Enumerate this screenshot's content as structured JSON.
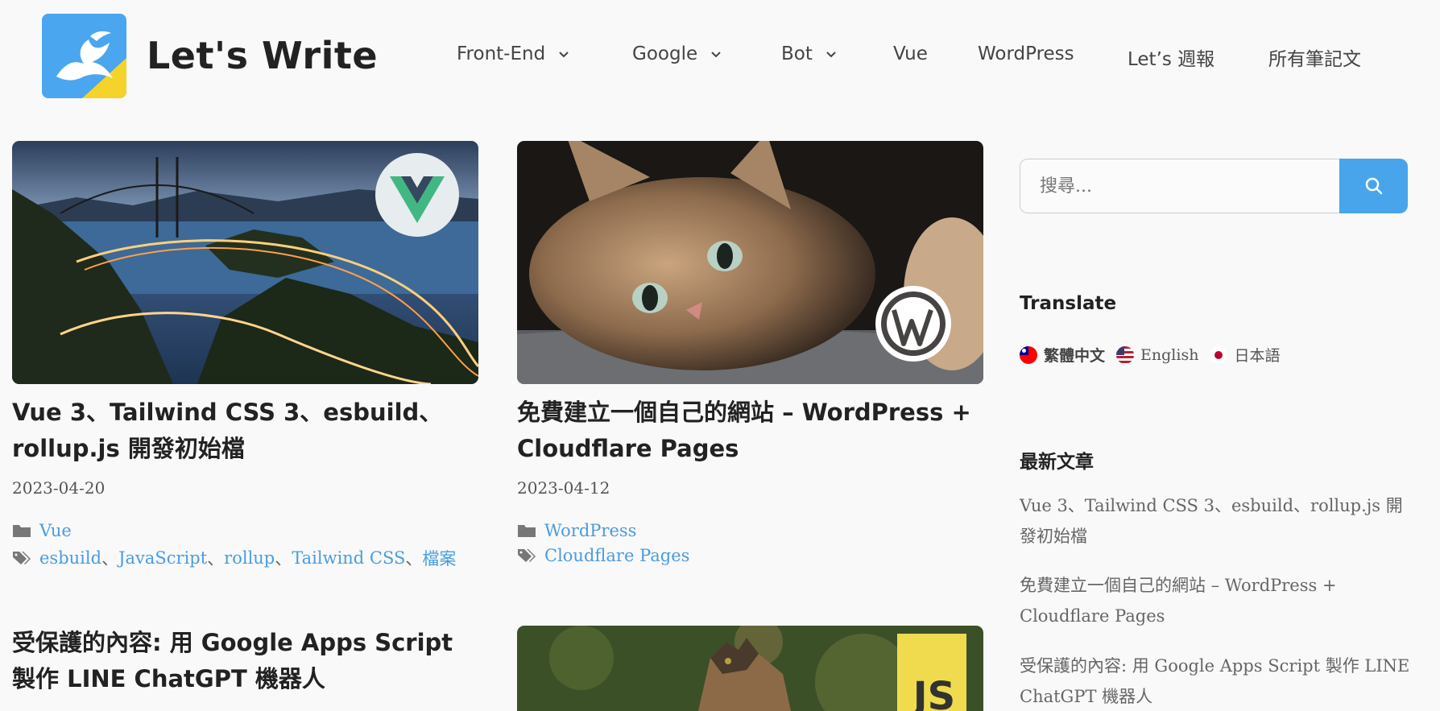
{
  "site": {
    "title": "Let's Write"
  },
  "nav": {
    "items": [
      {
        "label": "Front-End"
      },
      {
        "label": "Google"
      },
      {
        "label": "Bot"
      },
      {
        "label": "Vue"
      },
      {
        "label": "WordPress"
      },
      {
        "label": "Let’s 週報"
      },
      {
        "label": "所有筆記文"
      }
    ]
  },
  "posts": [
    {
      "title": "Vue 3、Tailwind CSS 3、esbuild、rollup.js 開發初始檔",
      "date": "2023-04-20",
      "category": "Vue",
      "tags": [
        "esbuild",
        "JavaScript",
        "rollup",
        "Tailwind CSS",
        "檔案"
      ],
      "tag_sep": "、",
      "image_icon": "vue-logo-icon"
    },
    {
      "title": "免費建立一個自己的網站 – WordPress + Cloudflare Pages",
      "date": "2023-04-12",
      "category": "WordPress",
      "tags": [
        "Cloudflare Pages"
      ],
      "image_icon": "wordpress-logo-icon"
    },
    {
      "title": "受保護的內容: 用 Google Apps Script 製作 LINE ChatGPT 機器人"
    },
    {
      "image_icon": "js-logo-icon",
      "image_badge": "JS"
    }
  ],
  "sidebar": {
    "search": {
      "placeholder": "搜尋..."
    },
    "translate": {
      "title": "Translate",
      "languages": [
        "繁體中文",
        "English",
        "日本語"
      ]
    },
    "recent": {
      "title": "最新文章",
      "items": [
        "Vue 3、Tailwind CSS 3、esbuild、rollup.js 開發初始檔",
        "免費建立一個自己的網站 – WordPress + Cloudflare Pages",
        "受保護的內容: 用 Google Apps Script 製作 LINE ChatGPT 機器人"
      ]
    }
  },
  "colors": {
    "accent": "#48a5ec",
    "link": "#4a9ce0",
    "background": "#f9f9f9"
  }
}
